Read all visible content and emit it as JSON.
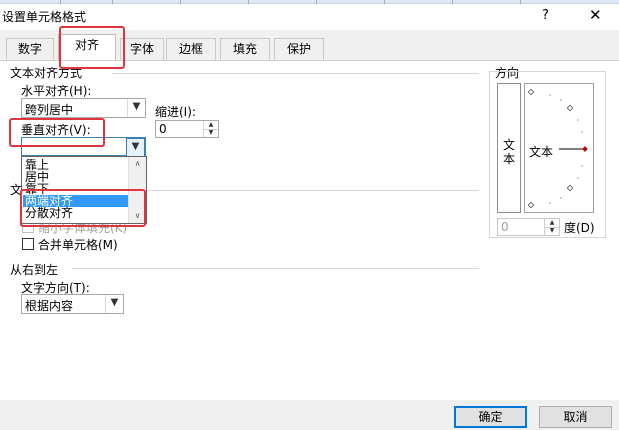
{
  "dialog": {
    "title": "设置单元格格式",
    "help": "?",
    "close": "✕"
  },
  "tabs": [
    {
      "label": "数字"
    },
    {
      "label": "对齐"
    },
    {
      "label": "字体"
    },
    {
      "label": "边框"
    },
    {
      "label": "填充"
    },
    {
      "label": "保护"
    }
  ],
  "active_tab": "对齐",
  "text_alignment": {
    "section_title": "文本对齐方式",
    "horizontal_label": "水平对齐(H):",
    "horizontal_value": "跨列居中",
    "indent_label": "缩进(I):",
    "indent_value": "0",
    "vertical_label": "垂直对齐(V):",
    "vertical_value": "",
    "vertical_options": [
      "靠上",
      "居中",
      "靠下",
      "两端对齐",
      "分散对齐"
    ],
    "vertical_highlighted": "两端对齐"
  },
  "text_control": {
    "section_title": "文本控制",
    "section_title_visible": "文本",
    "shrink_label": "缩小字体填充(K)",
    "merge_label": "合并单元格(M)"
  },
  "rtl": {
    "section_title": "从右到左",
    "direction_label": "文字方向(T):",
    "direction_value": "根据内容"
  },
  "orientation": {
    "section_title": "方向",
    "vertical_text": [
      "文",
      "本"
    ],
    "dial_text": "文本",
    "degrees_value": "0",
    "degrees_label": "度(D)"
  },
  "footer": {
    "ok": "确定",
    "cancel": "取消"
  },
  "colors": {
    "highlight": "#3399ff",
    "annotation": "#e0353f",
    "dial_marker": "#c00000",
    "default_button_border": "#0078d7"
  }
}
